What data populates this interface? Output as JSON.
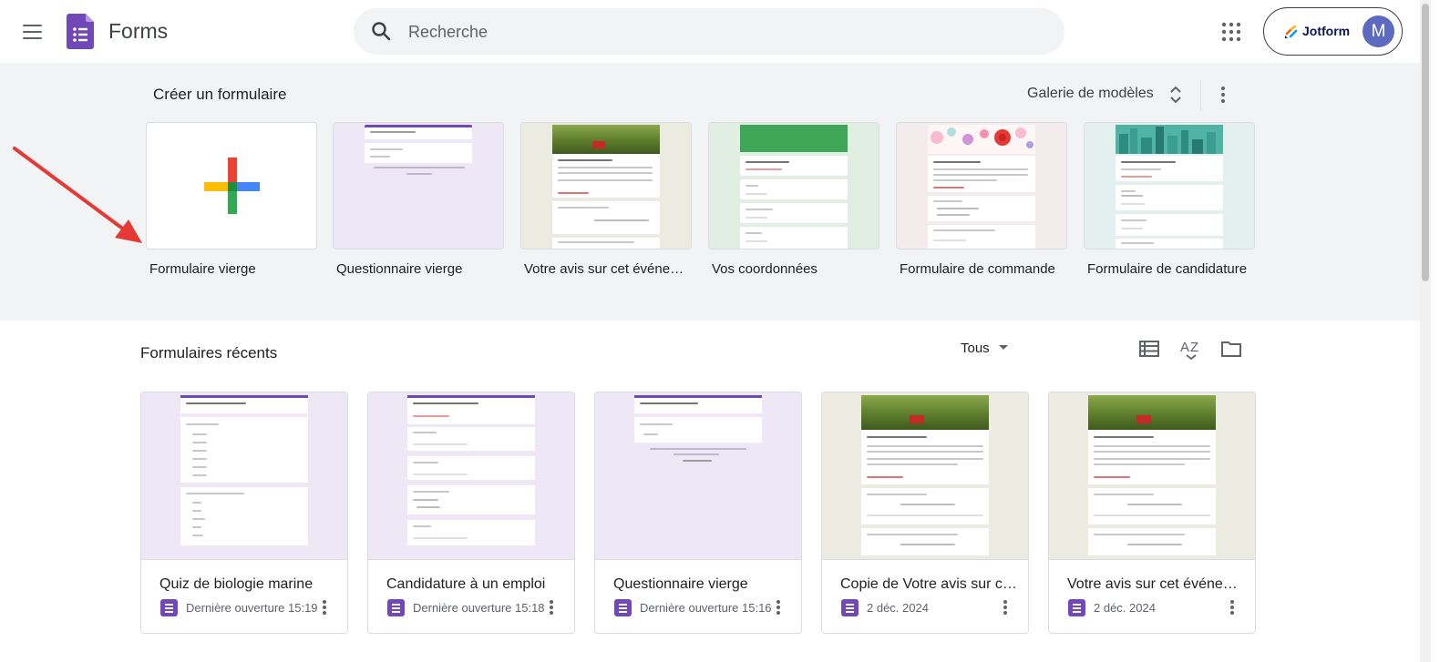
{
  "header": {
    "app_name": "Forms",
    "search_placeholder": "Recherche",
    "account": {
      "brand": "Jotform",
      "avatar_initial": "M"
    }
  },
  "gallery": {
    "title": "Créer un formulaire",
    "toggle_label": "Galerie de modèles",
    "templates": [
      {
        "label": "Formulaire vierge",
        "icon": "plus-icon"
      },
      {
        "label": "Questionnaire vierge"
      },
      {
        "label": "Votre avis sur cet événement"
      },
      {
        "label": "Vos coordonnées"
      },
      {
        "label": "Formulaire de commande"
      },
      {
        "label": "Formulaire de candidature"
      }
    ]
  },
  "recent": {
    "title": "Formulaires récents",
    "owner_filter": "Tous",
    "cards": [
      {
        "title": "Quiz de biologie marine",
        "date": "Dernière ouverture 15:19"
      },
      {
        "title": "Candidature à un emploi",
        "date": "Dernière ouverture 15:18"
      },
      {
        "title": "Questionnaire vierge",
        "date": "Dernière ouverture 15:16"
      },
      {
        "title": "Copie de Votre avis sur cet événement",
        "date": "2 déc. 2024"
      },
      {
        "title": "Votre avis sur cet événement",
        "date": "2 déc. 2024"
      }
    ]
  },
  "colors": {
    "forms_purple": "#7248b9",
    "gallery_bg": "#f1f3f4",
    "annotation_arrow": "#e53935"
  }
}
